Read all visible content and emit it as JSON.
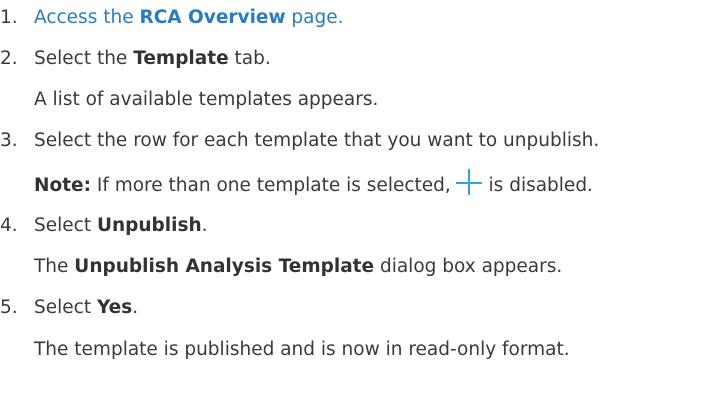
{
  "steps": [
    {
      "number": "1.",
      "prefix": "Access the ",
      "bold": "RCA Overview",
      "suffix": " page."
    },
    {
      "number": "2.",
      "prefix": "Select the ",
      "bold": "Template",
      "suffix": " tab.",
      "result": "A list of available templates appears."
    },
    {
      "number": "3.",
      "text": "Select the row for each template that you want to unpublish.",
      "note_label": "Note:",
      "note_text_before": " If more than one template is selected, ",
      "note_icon": "plus-icon",
      "note_text_after": " is disabled."
    },
    {
      "number": "4.",
      "prefix": "Select ",
      "bold": "Unpublish",
      "suffix": ".",
      "result_prefix": "The ",
      "result_bold": "Unpublish Analysis Template",
      "result_suffix": " dialog box appears."
    },
    {
      "number": "5.",
      "prefix": "Select ",
      "bold": "Yes",
      "suffix": ".",
      "result": "The template is published and is now in read-only format."
    }
  ],
  "colors": {
    "text": "#3a3a3a",
    "link": "#2b7bc0",
    "icon": "#2fa4dc"
  }
}
